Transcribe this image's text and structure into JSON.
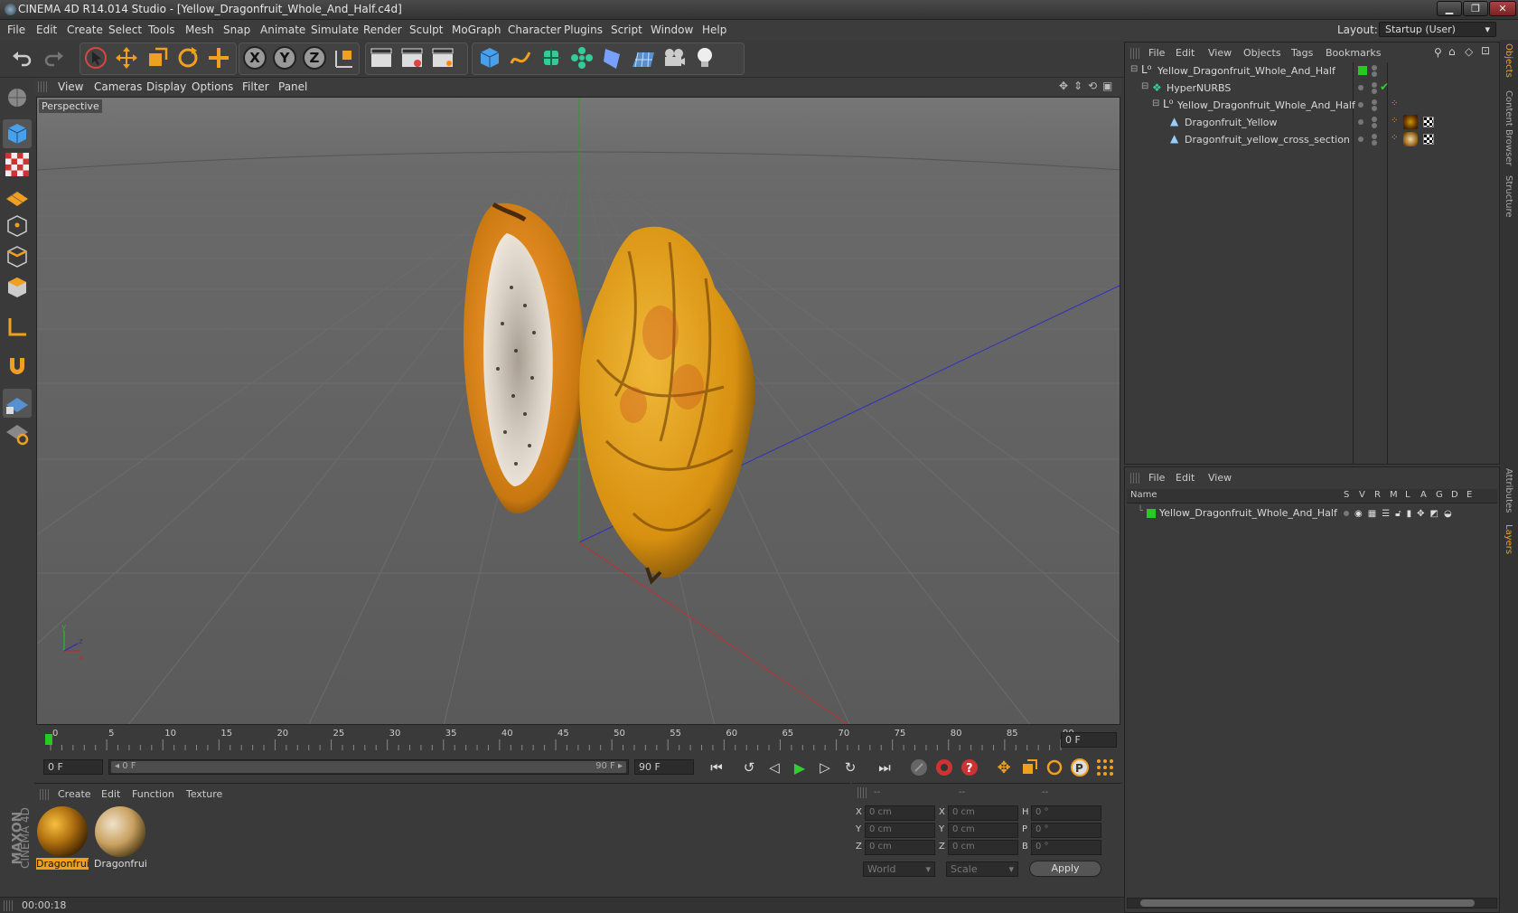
{
  "window": {
    "title": "CINEMA 4D R14.014 Studio - [Yellow_Dragonfruit_Whole_And_Half.c4d]",
    "min": "▁",
    "max": "❐",
    "close": "✕"
  },
  "menubar": {
    "items": [
      "File",
      "Edit",
      "Create",
      "Select",
      "Tools",
      "Mesh",
      "Snap",
      "Animate",
      "Simulate",
      "Render",
      "Sculpt",
      "MoGraph",
      "Character",
      "Plugins",
      "Script",
      "Window",
      "Help"
    ],
    "layout_label": "Layout:",
    "layout_value": "Startup (User)"
  },
  "viewport": {
    "menu": [
      "View",
      "Cameras",
      "Display",
      "Options",
      "Filter",
      "Panel"
    ],
    "label": "Perspective"
  },
  "timeline": {
    "ticks": [
      "0",
      "5",
      "10",
      "15",
      "20",
      "25",
      "30",
      "35",
      "40",
      "45",
      "50",
      "55",
      "60",
      "65",
      "70",
      "75",
      "80",
      "85",
      "90"
    ],
    "frame_field": "0 F"
  },
  "transport": {
    "start": "0 F",
    "range_left": "◂ 0 F",
    "range_right": "90 F ▸",
    "end": "90 F"
  },
  "material_manager": {
    "menu": [
      "Create",
      "Edit",
      "Function",
      "Texture"
    ],
    "materials": [
      {
        "label": "Dragonfrui"
      },
      {
        "label": "Dragonfrui"
      }
    ]
  },
  "coord_manager": {
    "headers": [
      "--",
      "--",
      "--"
    ],
    "rows": [
      {
        "a": "X",
        "av": "0 cm",
        "b": "X",
        "bv": "0 cm",
        "c": "H",
        "cv": "0 °"
      },
      {
        "a": "Y",
        "av": "0 cm",
        "b": "Y",
        "bv": "0 cm",
        "c": "P",
        "cv": "0 °"
      },
      {
        "a": "Z",
        "av": "0 cm",
        "b": "Z",
        "bv": "0 cm",
        "c": "B",
        "cv": "0 °"
      }
    ],
    "world": "World",
    "scale": "Scale",
    "apply": "Apply"
  },
  "status": {
    "time": "00:00:18"
  },
  "object_manager": {
    "menu": [
      "File",
      "Edit",
      "View",
      "Objects",
      "Tags",
      "Bookmarks"
    ],
    "objects": [
      "Yellow_Dragonfruit_Whole_And_Half",
      "HyperNURBS",
      "Yellow_Dragonfruit_Whole_And_Half",
      "Dragonfruit_Yellow",
      "Dragonfruit_yellow_cross_section"
    ]
  },
  "layer_manager": {
    "menu": [
      "File",
      "Edit",
      "View"
    ],
    "header_name": "Name",
    "cols": [
      "S",
      "V",
      "R",
      "M",
      "L",
      "A",
      "G",
      "D",
      "E"
    ],
    "layer": "Yellow_Dragonfruit_Whole_And_Half",
    "layer_color": "#22cc22"
  },
  "side_tabs": [
    "Objects",
    "Content Browser",
    "Structure",
    "Attributes",
    "Layers"
  ],
  "brand": {
    "maxon": "MAXON",
    "c4d": "CINEMA 4D"
  }
}
